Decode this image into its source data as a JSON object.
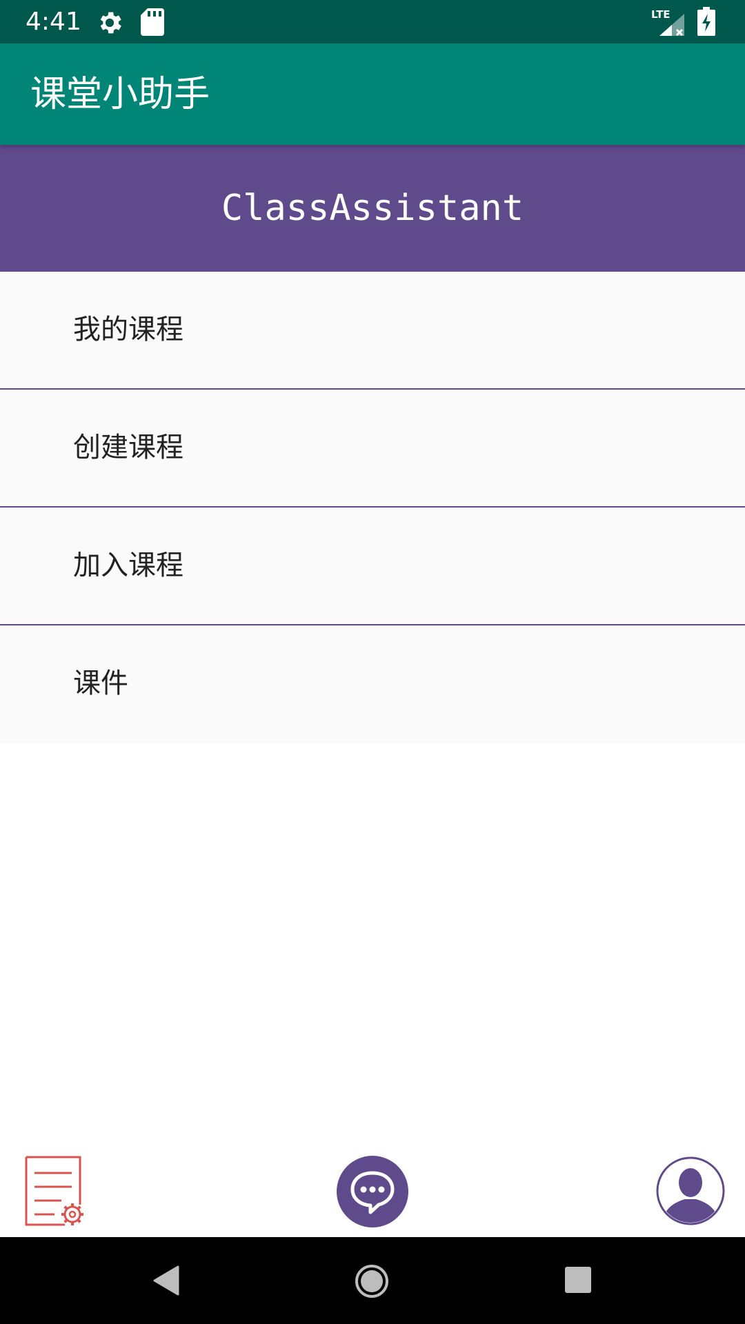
{
  "status_bar": {
    "time": "4:41",
    "network": "LTE",
    "icons": [
      "gear-icon",
      "sd-card-icon",
      "lte-signal-icon",
      "battery-charging-icon"
    ]
  },
  "app_bar": {
    "title": "课堂小助手"
  },
  "banner": {
    "text": "ClassAssistant"
  },
  "menu": {
    "items": [
      {
        "label": "我的课程"
      },
      {
        "label": "创建课程"
      },
      {
        "label": "加入课程"
      },
      {
        "label": "课件"
      }
    ]
  },
  "bottom_bar": {
    "icons": [
      "document-settings-icon",
      "chat-icon",
      "profile-icon"
    ]
  },
  "nav_bar": {
    "icons": [
      "back-icon",
      "home-icon",
      "recents-icon"
    ]
  },
  "colors": {
    "status_bar": "#00574b",
    "app_bar": "#008577",
    "accent": "#5f4b8b",
    "doc_icon": "#d9534f",
    "menu_bg": "#fafafa"
  }
}
